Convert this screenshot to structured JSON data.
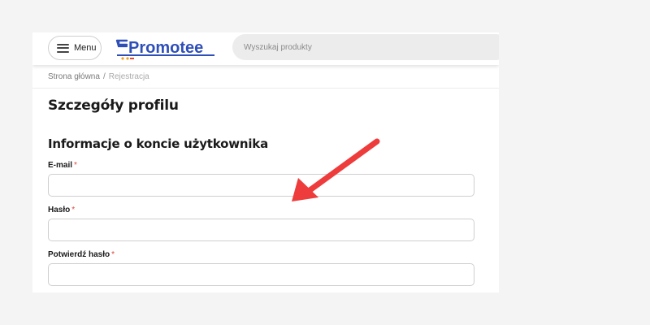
{
  "header": {
    "menu_label": "Menu",
    "logo_text": "Promotee",
    "search_placeholder": "Wyszukaj produkty"
  },
  "breadcrumb": {
    "home": "Strona główna",
    "separator": "/",
    "current": "Rejestracja"
  },
  "page": {
    "title": "Szczegóły profilu",
    "section_title": "Informacje o koncie użytkownika"
  },
  "form": {
    "required_marker": "*",
    "fields": [
      {
        "label": "E-mail",
        "value": ""
      },
      {
        "label": "Hasło",
        "value": ""
      },
      {
        "label": "Potwierdź hasło",
        "value": ""
      }
    ]
  },
  "colors": {
    "brand_blue": "#2f4fb8",
    "required_red": "#e0463f",
    "annotation_arrow": "#ee3b3b"
  },
  "annotation": {
    "icon": "red-arrow-icon"
  }
}
